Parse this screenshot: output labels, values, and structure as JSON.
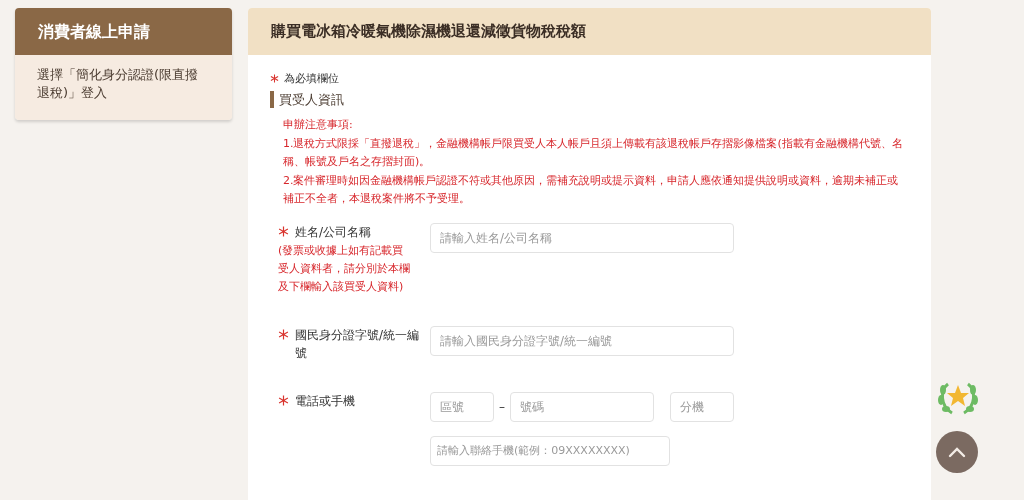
{
  "sidebar": {
    "title": "消費者線上申請",
    "items": [
      {
        "label": "選擇「簡化身分認證(限直撥退稅)」登入"
      }
    ]
  },
  "main": {
    "title": "購買電冰箱冷暖氣機除濕機退還減徵貨物稅稅額",
    "required_note": "為必填欄位",
    "section": "買受人資訊",
    "notice": {
      "title": "申辦注意事項:",
      "lines": [
        "1.退稅方式限採「直撥退稅」，金融機構帳戶限買受人本人帳戶且須上傳載有該退稅帳戶存摺影像檔案(指載有金融機構代號、名稱、帳號及戶名之存摺封面)。",
        "2.案件審理時如因金融機構帳戶認證不符或其他原因，需補充說明或提示資料，申請人應依通知提供說明或資料，逾期未補正或補正不全者，本退稅案件將不予受理。"
      ]
    },
    "fields": [
      {
        "kind": "text",
        "label": "姓名/公司名稱",
        "required": true,
        "note": "(發票或收據上如有記載買受人資料者，請分別於本欄及下欄輸入該買受人資料)",
        "placeholder": "請輸入姓名/公司名稱"
      },
      {
        "kind": "text",
        "label": "國民身分證字號/統一編號",
        "required": true,
        "placeholder": "請輸入國民身分證字號/統一編號"
      },
      {
        "kind": "phone",
        "label": "電話或手機",
        "required": true,
        "area_placeholder": "區號",
        "separator": "–",
        "number_placeholder": "號碼",
        "ext_placeholder": "分機",
        "mobile_placeholder": "請輸入聯絡手機(範例：09XXXXXXXX)"
      }
    ]
  }
}
